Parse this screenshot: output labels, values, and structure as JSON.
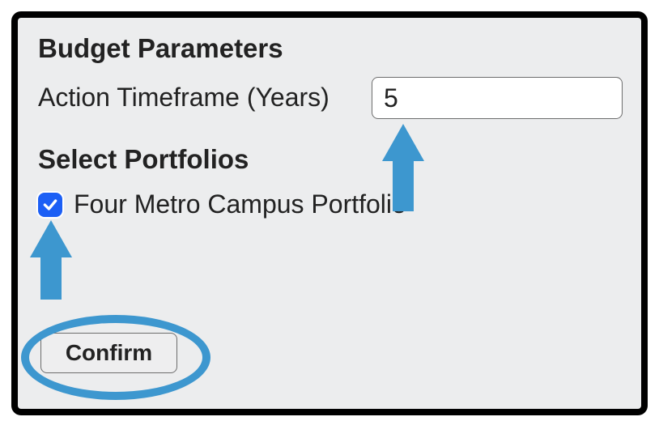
{
  "headings": {
    "budget": "Budget Parameters",
    "portfolios": "Select Portfolios"
  },
  "timeframe": {
    "label": "Action Timeframe (Years)",
    "value": "5"
  },
  "portfolios": {
    "items": [
      {
        "label": "Four Metro Campus Portfolio",
        "checked": true
      }
    ]
  },
  "buttons": {
    "confirm": "Confirm"
  },
  "annotations": {
    "arrow_color": "#3d97cf"
  }
}
